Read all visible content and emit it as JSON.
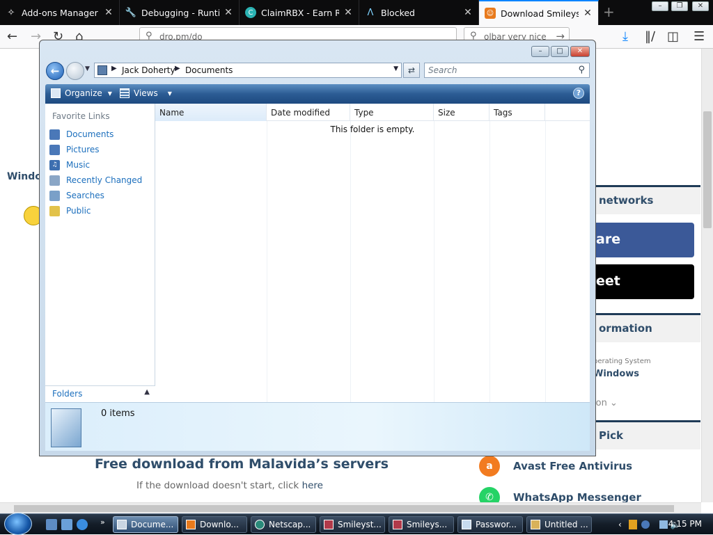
{
  "browser": {
    "tabs": [
      {
        "title": "Add-ons Manager",
        "icon": "puzzle-icon",
        "active": false
      },
      {
        "title": "Debugging - Runtim",
        "icon": "wrench-icon",
        "active": false
      },
      {
        "title": "ClaimRBX - Earn Robu",
        "icon": "claimrbx-icon",
        "active": false
      },
      {
        "title": "Blocked",
        "icon": "lambda-icon",
        "active": false
      },
      {
        "title": "Download Smileystor",
        "icon": "smileys-icon",
        "active": true
      }
    ],
    "url": "dro.pm/do",
    "search_text": "olbar very nice",
    "window_buttons": [
      "–",
      "❐",
      "✕"
    ]
  },
  "webpage": {
    "window_label": "Window",
    "sections": [
      "networks",
      "ormation",
      "Pick"
    ],
    "share_label": "are",
    "tweet_label": "eet",
    "os_label": "perating System",
    "os_value": "Windows",
    "more_label": "ion",
    "free_download": "Free download from Malavida’s servers",
    "download_note_text": "If the download doesn't start, click",
    "download_note_link": "here",
    "apps": [
      {
        "name": "Avast Free Antivirus",
        "icon": "avast-icon",
        "color": "#f27b20"
      },
      {
        "name": "WhatsApp Messenger",
        "icon": "whatsapp-icon",
        "color": "#25d366"
      }
    ]
  },
  "explorer": {
    "breadcrumb": [
      "Jack Doherty",
      "Documents"
    ],
    "search_placeholder": "Search",
    "toolbar": {
      "organize": "Organize",
      "views": "Views",
      "help": "?"
    },
    "nav": {
      "heading": "Favorite Links",
      "items": [
        {
          "label": "Documents",
          "icon": "documents-icon",
          "color": "#4a78b8"
        },
        {
          "label": "Pictures",
          "icon": "pictures-icon",
          "color": "#4a78b8"
        },
        {
          "label": "Music",
          "icon": "music-icon",
          "color": "#3d6fb0"
        },
        {
          "label": "Recently Changed",
          "icon": "recent-icon",
          "color": "#8aa6c6"
        },
        {
          "label": "Searches",
          "icon": "searches-icon",
          "color": "#7aa0c8"
        },
        {
          "label": "Public",
          "icon": "public-folder-icon",
          "color": "#e2c24a"
        }
      ],
      "folders_label": "Folders"
    },
    "columns": [
      "Name",
      "Date modified",
      "Type",
      "Size",
      "Tags"
    ],
    "empty_message": "This folder is empty.",
    "items_count": "0 items"
  },
  "taskbar": {
    "tasks": [
      {
        "label": "Docume...",
        "active": true
      },
      {
        "label": "Downlo...",
        "active": false
      },
      {
        "label": "Netscap...",
        "active": false
      },
      {
        "label": "Smileyst...",
        "active": false
      },
      {
        "label": "Smileys...",
        "active": false
      },
      {
        "label": "Passwor...",
        "active": false
      },
      {
        "label": "Untitled ...",
        "active": false
      }
    ],
    "clock": "4:15 PM"
  }
}
